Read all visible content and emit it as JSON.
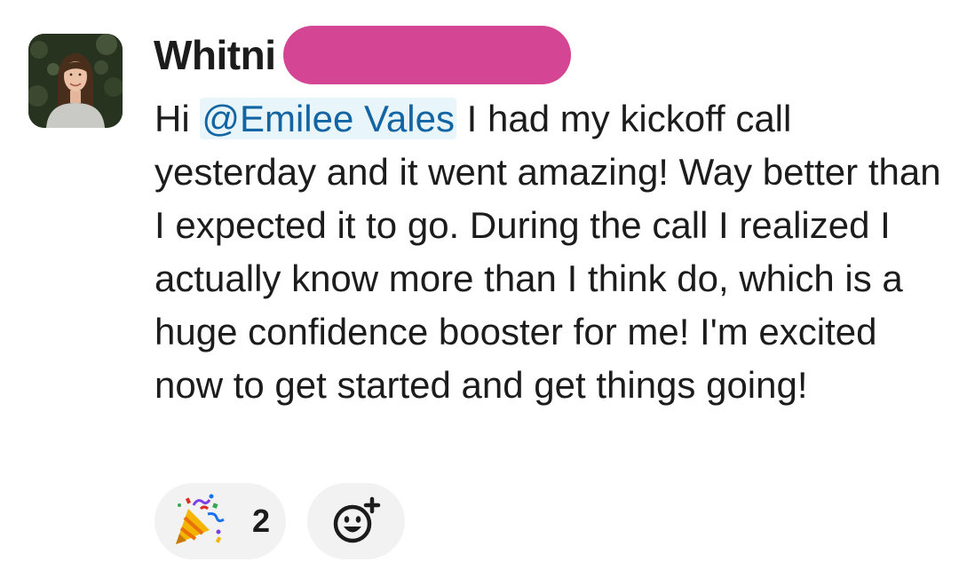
{
  "message": {
    "sender_name": "Whitni",
    "sender_redaction_color": "#d44693",
    "mention": "@Emilee Vales",
    "text_before_mention": "Hi ",
    "text_after_mention": " I had my kickoff call yesterday and it went amazing! Way better than I expected it to go. During the call I realized I actually know more than I think do, which is a huge confidence booster for me! I'm excited now to get started and get things going!"
  },
  "reactions": [
    {
      "icon": "party-popper-icon",
      "count": "2"
    }
  ],
  "add_reaction": {
    "icon": "add-emoji-icon"
  },
  "colors": {
    "mention_text": "#1264a3",
    "mention_bg": "#e8f5fa",
    "pill_bg": "#f2f2f2"
  }
}
